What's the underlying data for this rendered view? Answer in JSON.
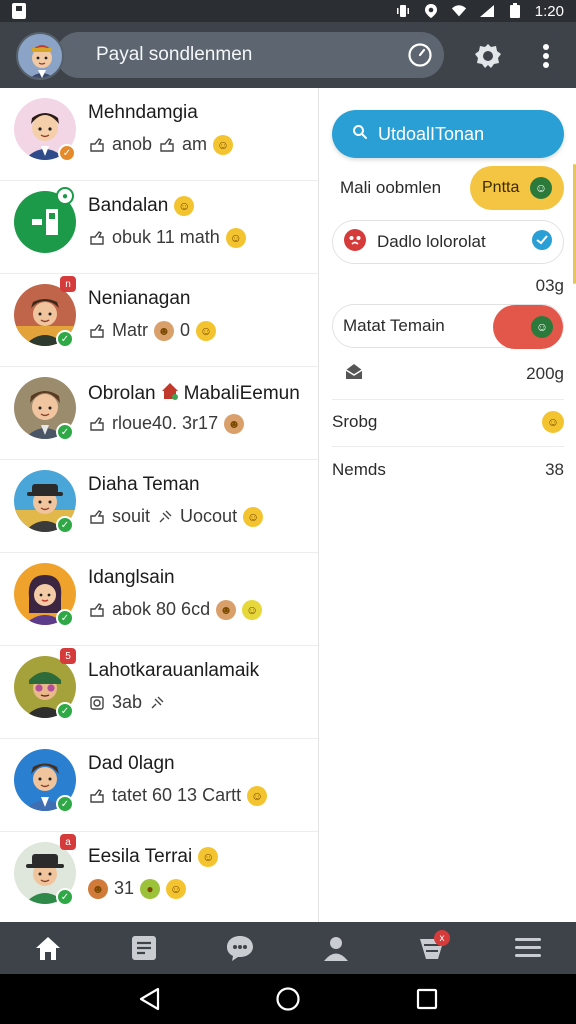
{
  "status_bar": {
    "time": "1:20",
    "icons": [
      "sim-icon",
      "vibrate-icon",
      "location-icon",
      "wifi-icon",
      "signal-icon",
      "battery-icon"
    ]
  },
  "header": {
    "search_text": "Payal sondlenmen",
    "icons": [
      "profile-avatar",
      "clock-icon",
      "settings-icon",
      "more-icon"
    ]
  },
  "chats": [
    {
      "name": "Mehndamgia",
      "preview": "anob",
      "preview2": "am",
      "badge": "orange"
    },
    {
      "name": "Bandalan",
      "preview": "obuk 11 math",
      "preview2": "",
      "badge": "green"
    },
    {
      "name": "Nenianagan",
      "preview": "Matr",
      "preview2": "0",
      "badge": "green"
    },
    {
      "name": "Obrolan",
      "name2": "MabaliEemun",
      "preview": "rloue40. 3r17",
      "preview2": "",
      "badge": "green"
    },
    {
      "name": "Diaha Teman",
      "preview": "souit",
      "preview2": "Uocout",
      "badge": "green"
    },
    {
      "name": "Idanglsain",
      "preview": "abok 80 6cd",
      "preview2": "",
      "badge": "green"
    },
    {
      "name": "Lahotkarauanlamaik",
      "preview": "3ab",
      "preview2": "",
      "badge": "green"
    },
    {
      "name": "Dad 0lagn",
      "preview": "tatet 60 13 Cartt",
      "preview2": "",
      "badge": "green"
    },
    {
      "name": "Eesila Terrai",
      "preview": "31",
      "preview2": "",
      "badge": "green"
    }
  ],
  "panel": {
    "friend_button": "UtdoalITonan",
    "row1_label": "Mali oobmlen",
    "row1_chip": "Pntta",
    "row2_label": "Dadlo lolorolat",
    "value1": "03g",
    "row3_label": "Matat Temain",
    "value2": "200g",
    "row4_label": "Srobg",
    "row5_label": "Nemds",
    "row5_value": "38"
  },
  "bottom_nav": {
    "items": [
      "home-icon",
      "news-icon",
      "chat-icon",
      "profile-icon",
      "notifications-icon",
      "menu-icon"
    ],
    "notification_badge": "x"
  },
  "colors": {
    "header_bg": "#3d4349",
    "accent_blue": "#2a9fd6",
    "chip_yellow": "#f4c542",
    "chip_red": "#e3574a",
    "badge_green": "#2fa846"
  }
}
